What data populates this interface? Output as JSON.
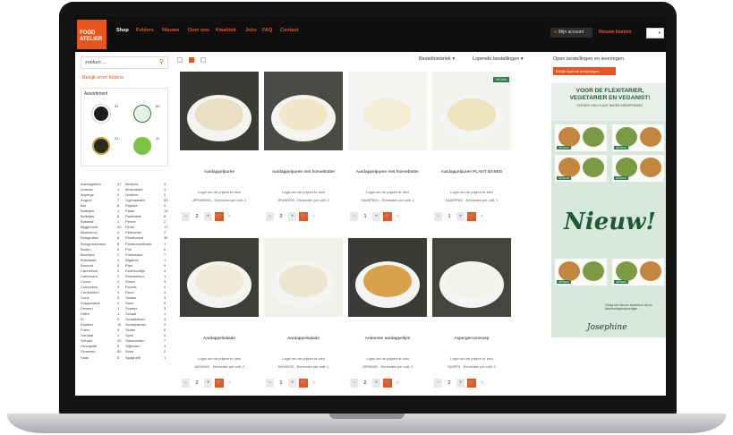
{
  "nav": {
    "logo_line1": "FOOD",
    "logo_line2": "ATELIER",
    "links": [
      "Shop",
      "Folders",
      "Nieuws",
      "Over ons",
      "Kwaliteit",
      "Jobs",
      "FAQ",
      "Contact"
    ],
    "active": "Shop",
    "account_label": "Mijn account",
    "news_label": "Nieuwe klanten",
    "lang_caret": "▾"
  },
  "sidebar": {
    "search_placeholder": "zoeken ...",
    "folders_link": "Bekijk onze folders",
    "assortment_title": "Assortiment",
    "brand_counts": [
      "31",
      "60",
      "21",
      "11"
    ],
    "filters_left": [
      [
        "Aardappelen",
        "37"
      ],
      [
        "Ananas",
        "1"
      ],
      [
        "Asperge",
        "2"
      ],
      [
        "Augurk",
        "7"
      ],
      [
        "Bal",
        "8"
      ],
      [
        "Balletjes",
        "1"
      ],
      [
        "Bolletjes",
        "8"
      ],
      [
        "Basmati",
        "1"
      ],
      [
        "Biggerecht",
        "20"
      ],
      [
        "Bloemkool",
        "4"
      ],
      [
        "Bolognaise",
        "6"
      ],
      [
        "Bolognaisesaus",
        "8"
      ],
      [
        "Bonen",
        "6"
      ],
      [
        "Boontjes",
        "2"
      ],
      [
        "Brikelaaie",
        "1"
      ],
      [
        "Broccoli",
        "8"
      ],
      [
        "Cannelloni",
        "3"
      ],
      [
        "Carbonara",
        "2"
      ],
      [
        "Cocos",
        "1"
      ],
      [
        "Compotine",
        "9"
      ],
      [
        "Cordonbleu",
        "1"
      ],
      [
        "Curry",
        "3"
      ],
      [
        "Dragonsaus",
        "4"
      ],
      [
        "Dessert",
        "1"
      ],
      [
        "Dillen",
        "1"
      ],
      [
        "Ei",
        "9"
      ],
      [
        "Eiwitten",
        "15"
      ],
      [
        "Frieto",
        "5"
      ],
      [
        "Garnaal",
        "1"
      ],
      [
        "Gehakt",
        "20"
      ],
      [
        "Gevogelte",
        "9"
      ],
      [
        "Groenten",
        "50"
      ],
      [
        "Kaas",
        "6"
      ]
    ],
    "filters_right": [
      [
        "Mosterd",
        "3"
      ],
      [
        "Mozzarella",
        "1"
      ],
      [
        "Oesters",
        "2"
      ],
      [
        "Ogenaarden",
        "83"
      ],
      [
        "Paprika",
        "5"
      ],
      [
        "Pasta",
        "13"
      ],
      [
        "Pastinaak",
        "8"
      ],
      [
        "Penne",
        "2"
      ],
      [
        "Pesto",
        "17"
      ],
      [
        "Peterselie",
        "2"
      ],
      [
        "Plantbased",
        "30"
      ],
      [
        "Plantbasedbasis",
        "1"
      ],
      [
        "Prei",
        "6"
      ],
      [
        "Puréesaus",
        "7"
      ],
      [
        "Rigatoni",
        "1"
      ],
      [
        "Rijst",
        "9"
      ],
      [
        "Rodekoolfijn",
        "3"
      ],
      [
        "Romanesco",
        "1"
      ],
      [
        "Room",
        "3"
      ],
      [
        "Rucola",
        "4"
      ],
      [
        "Rund",
        "3"
      ],
      [
        "Salade",
        "3"
      ],
      [
        "Saus",
        "9"
      ],
      [
        "Scampi",
        "3"
      ],
      [
        "Schaal",
        "1"
      ],
      [
        "Schaalderen",
        "4"
      ],
      [
        "Schelpdieren",
        "2"
      ],
      [
        "Selder",
        "6"
      ],
      [
        "Spek",
        "3"
      ],
      [
        "Stamnenten",
        "7"
      ],
      [
        "Stijlkoren",
        "4"
      ],
      [
        "Soep",
        "2"
      ],
      [
        "Spaghetti",
        "1"
      ]
    ]
  },
  "toolbar": {
    "history_label": "Bestelhistoriek",
    "running_label": "Lopende bestellingen",
    "caret": "▾"
  },
  "products": [
    {
      "name": "Aardappelpuree",
      "badge": "",
      "login": "Login om de prijzen te zien",
      "sku": "JPPUM0001 - Eenheden per colli: 2",
      "qty": "2"
    },
    {
      "name": "Aardappelpuree met hoevebotter",
      "badge": "",
      "login": "Login om de prijzen te zien",
      "sku": "JPUM0005 - Eenheden per colli: 2",
      "qty": "2"
    },
    {
      "name": "Aardappelpuree met hoevebotter",
      "badge": "",
      "login": "Login om de prijzen te zien",
      "sku": "9AARPNO1 - Eenheden per colli: 1",
      "qty": "1"
    },
    {
      "name": "Aardappelpuree PLANT BASED",
      "badge": "VEGAN",
      "login": "Login om de prijzen te zien",
      "sku": "SAARPN01 - Eenheden per colli: 1",
      "qty": "1"
    },
    {
      "name": "Aardappelsalade",
      "badge": "",
      "login": "Login om de prijzen te zien",
      "sku": "JAS40000 - Eenheden per colli: 2",
      "qty": "2"
    },
    {
      "name": "Aardappelsalade",
      "badge": "",
      "login": "Login om de prijzen te zien",
      "sku": "5AS40010 - Eenheden per colli: 1",
      "qty": "1"
    },
    {
      "name": "Ardeense aardappeltjes",
      "badge": "",
      "login": "Login om de prijzen te zien",
      "sku": "JSFB0400 - Eenheden per colli: 2",
      "qty": "2"
    },
    {
      "name": "Aspergeroomsoep",
      "badge": "",
      "login": "Login om de prijzen te zien",
      "sku": "SASP01 - Eenheden per colli: 2",
      "qty": "2"
    }
  ],
  "qty_controls": {
    "minus": "−",
    "plus": "+",
    "cart": "🛒",
    "remove": "×"
  },
  "right_panel": {
    "title": "Open bestellingen en leveringen",
    "order_button": "Bekijk lopende bestellingen",
    "promo_headline": "VOOR DE FLEXITARIER, VEGETARIER EN VEGANIST!",
    "promo_sub": "ONTDEK ONS PLANT BASED ASSORTIMENT",
    "meal_labels": [
      "JPOO14",
      "JPOO16",
      "JPOO18",
      "JPOO20",
      "JPOO22",
      "JPOO24"
    ],
    "nieuw": "Nieuw!",
    "promo_foot": "Vraag uw nieuwe bestelbon bij uw klantvertegenwoordiger.",
    "promo_brand": "Josephine"
  }
}
